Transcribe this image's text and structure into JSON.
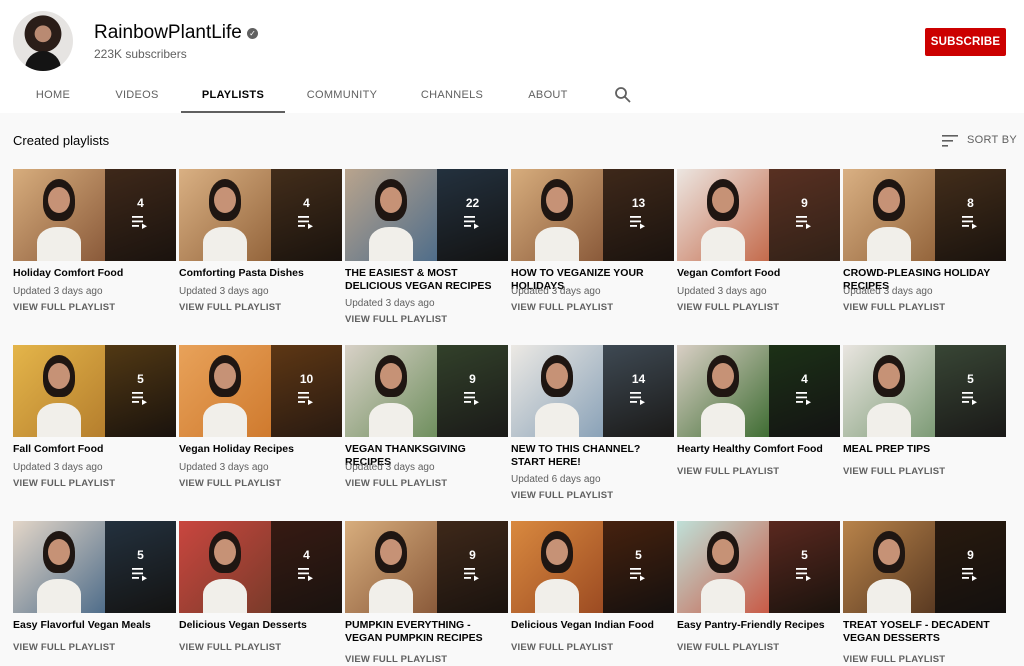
{
  "channel": {
    "name": "RainbowPlantLife",
    "subscribers": "223K subscribers",
    "subscribe_label": "SUBSCRIBE",
    "verified_icon": "check-circle-icon"
  },
  "tabs": [
    {
      "label": "HOME",
      "active": false
    },
    {
      "label": "VIDEOS",
      "active": false
    },
    {
      "label": "PLAYLISTS",
      "active": true
    },
    {
      "label": "COMMUNITY",
      "active": false
    },
    {
      "label": "CHANNELS",
      "active": false
    },
    {
      "label": "ABOUT",
      "active": false
    }
  ],
  "section": {
    "title": "Created playlists",
    "sort_label": "SORT BY"
  },
  "colors": {
    "subscribe": "#cc0000",
    "text_primary": "#030303",
    "text_secondary": "#606060",
    "background": "#f9f9f9"
  },
  "playlists": [
    {
      "title": "Holiday Comfort Food",
      "count": "4",
      "updated": "Updated 3 days ago",
      "link": "VIEW FULL PLAYLIST"
    },
    {
      "title": "Comforting Pasta Dishes",
      "count": "4",
      "updated": "Updated 3 days ago",
      "link": "VIEW FULL PLAYLIST"
    },
    {
      "title": "THE EASIEST & MOST DELICIOUS VEGAN RECIPES",
      "count": "22",
      "updated": "Updated 3 days ago",
      "link": "VIEW FULL PLAYLIST"
    },
    {
      "title": "HOW TO VEGANIZE YOUR HOLIDAYS",
      "count": "13",
      "updated": "Updated 3 days ago",
      "link": "VIEW FULL PLAYLIST"
    },
    {
      "title": "Vegan Comfort Food",
      "count": "9",
      "updated": "Updated 3 days ago",
      "link": "VIEW FULL PLAYLIST"
    },
    {
      "title": "CROWD-PLEASING HOLIDAY RECIPES",
      "count": "8",
      "updated": "Updated 3 days ago",
      "link": "VIEW FULL PLAYLIST"
    },
    {
      "title": "Fall Comfort Food",
      "count": "5",
      "updated": "Updated 3 days ago",
      "link": "VIEW FULL PLAYLIST"
    },
    {
      "title": "Vegan Holiday Recipes",
      "count": "10",
      "updated": "Updated 3 days ago",
      "link": "VIEW FULL PLAYLIST"
    },
    {
      "title": "VEGAN THANKSGIVING RECIPES",
      "count": "9",
      "updated": "Updated 3 days ago",
      "link": "VIEW FULL PLAYLIST"
    },
    {
      "title": "NEW TO THIS CHANNEL? START HERE!",
      "count": "14",
      "updated": "Updated 6 days ago",
      "link": "VIEW FULL PLAYLIST"
    },
    {
      "title": "Hearty Healthy Comfort Food",
      "count": "4",
      "updated": "",
      "link": "VIEW FULL PLAYLIST"
    },
    {
      "title": "MEAL PREP TIPS",
      "count": "5",
      "updated": "",
      "link": "VIEW FULL PLAYLIST"
    },
    {
      "title": "Easy Flavorful Vegan Meals",
      "count": "5",
      "updated": "",
      "link": "VIEW FULL PLAYLIST"
    },
    {
      "title": "Delicious Vegan Desserts",
      "count": "4",
      "updated": "",
      "link": "VIEW FULL PLAYLIST"
    },
    {
      "title": "PUMPKIN EVERYTHING - VEGAN PUMPKIN RECIPES",
      "count": "9",
      "updated": "",
      "link": "VIEW FULL PLAYLIST"
    },
    {
      "title": "Delicious Vegan Indian Food",
      "count": "5",
      "updated": "",
      "link": "VIEW FULL PLAYLIST"
    },
    {
      "title": "Easy Pantry-Friendly Recipes",
      "count": "5",
      "updated": "",
      "link": "VIEW FULL PLAYLIST"
    },
    {
      "title": "TREAT YOSELF - DECADENT VEGAN DESSERTS",
      "count": "9",
      "updated": "",
      "link": "VIEW FULL PLAYLIST"
    }
  ]
}
